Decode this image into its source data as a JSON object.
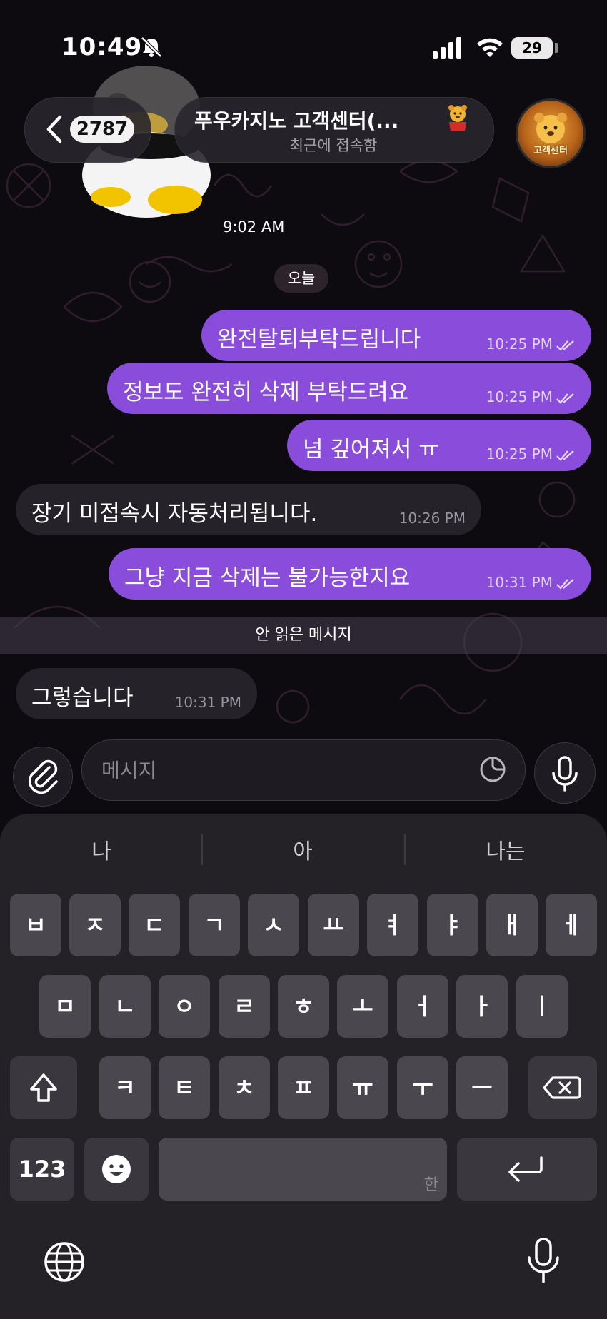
{
  "status_bar": {
    "time": "10:49",
    "battery": "29"
  },
  "header": {
    "back_count": "2787",
    "title": "푸우카지노 고객센터(...",
    "subtitle": "최근에 접속함",
    "avatar_label": "고객센터"
  },
  "timeline": {
    "floating_time": "9:02 AM",
    "date_chip": "오늘"
  },
  "messages": [
    {
      "direction": "outgoing",
      "text": "완전탈퇴부탁드립니다",
      "time": "10:25 PM",
      "read": true
    },
    {
      "direction": "outgoing",
      "text": "정보도 완전히 삭제 부탁드려요",
      "time": "10:25 PM",
      "read": true
    },
    {
      "direction": "outgoing",
      "text": "넘 깊어져서 ㅠ",
      "time": "10:25 PM",
      "read": true
    },
    {
      "direction": "incoming",
      "text": "장기 미접속시 자동처리됩니다.",
      "time": "10:26 PM"
    },
    {
      "direction": "outgoing",
      "text": "그냥 지금 삭제는 불가능한지요",
      "time": "10:31 PM",
      "read": true
    },
    {
      "direction": "incoming",
      "text": "그렇습니다",
      "time": "10:31 PM"
    }
  ],
  "unread_divider": "안 읽은 메시지",
  "composer": {
    "placeholder": "메시지"
  },
  "keyboard": {
    "suggestions": [
      "나",
      "아",
      "나는"
    ],
    "row1": [
      "ㅂ",
      "ㅈ",
      "ㄷ",
      "ㄱ",
      "ㅅ",
      "ㅛ",
      "ㅕ",
      "ㅑ",
      "ㅐ",
      "ㅔ"
    ],
    "row2": [
      "ㅁ",
      "ㄴ",
      "ㅇ",
      "ㄹ",
      "ㅎ",
      "ㅗ",
      "ㅓ",
      "ㅏ",
      "ㅣ"
    ],
    "row3": [
      "ㅋ",
      "ㅌ",
      "ㅊ",
      "ㅍ",
      "ㅠ",
      "ㅜ",
      "ㅡ"
    ],
    "numbers_key": "123",
    "space_label": "한"
  },
  "colors": {
    "outgoing_bubble": "#8a4ddb",
    "incoming_bubble": "#26222a",
    "background": "#0e0b10"
  }
}
